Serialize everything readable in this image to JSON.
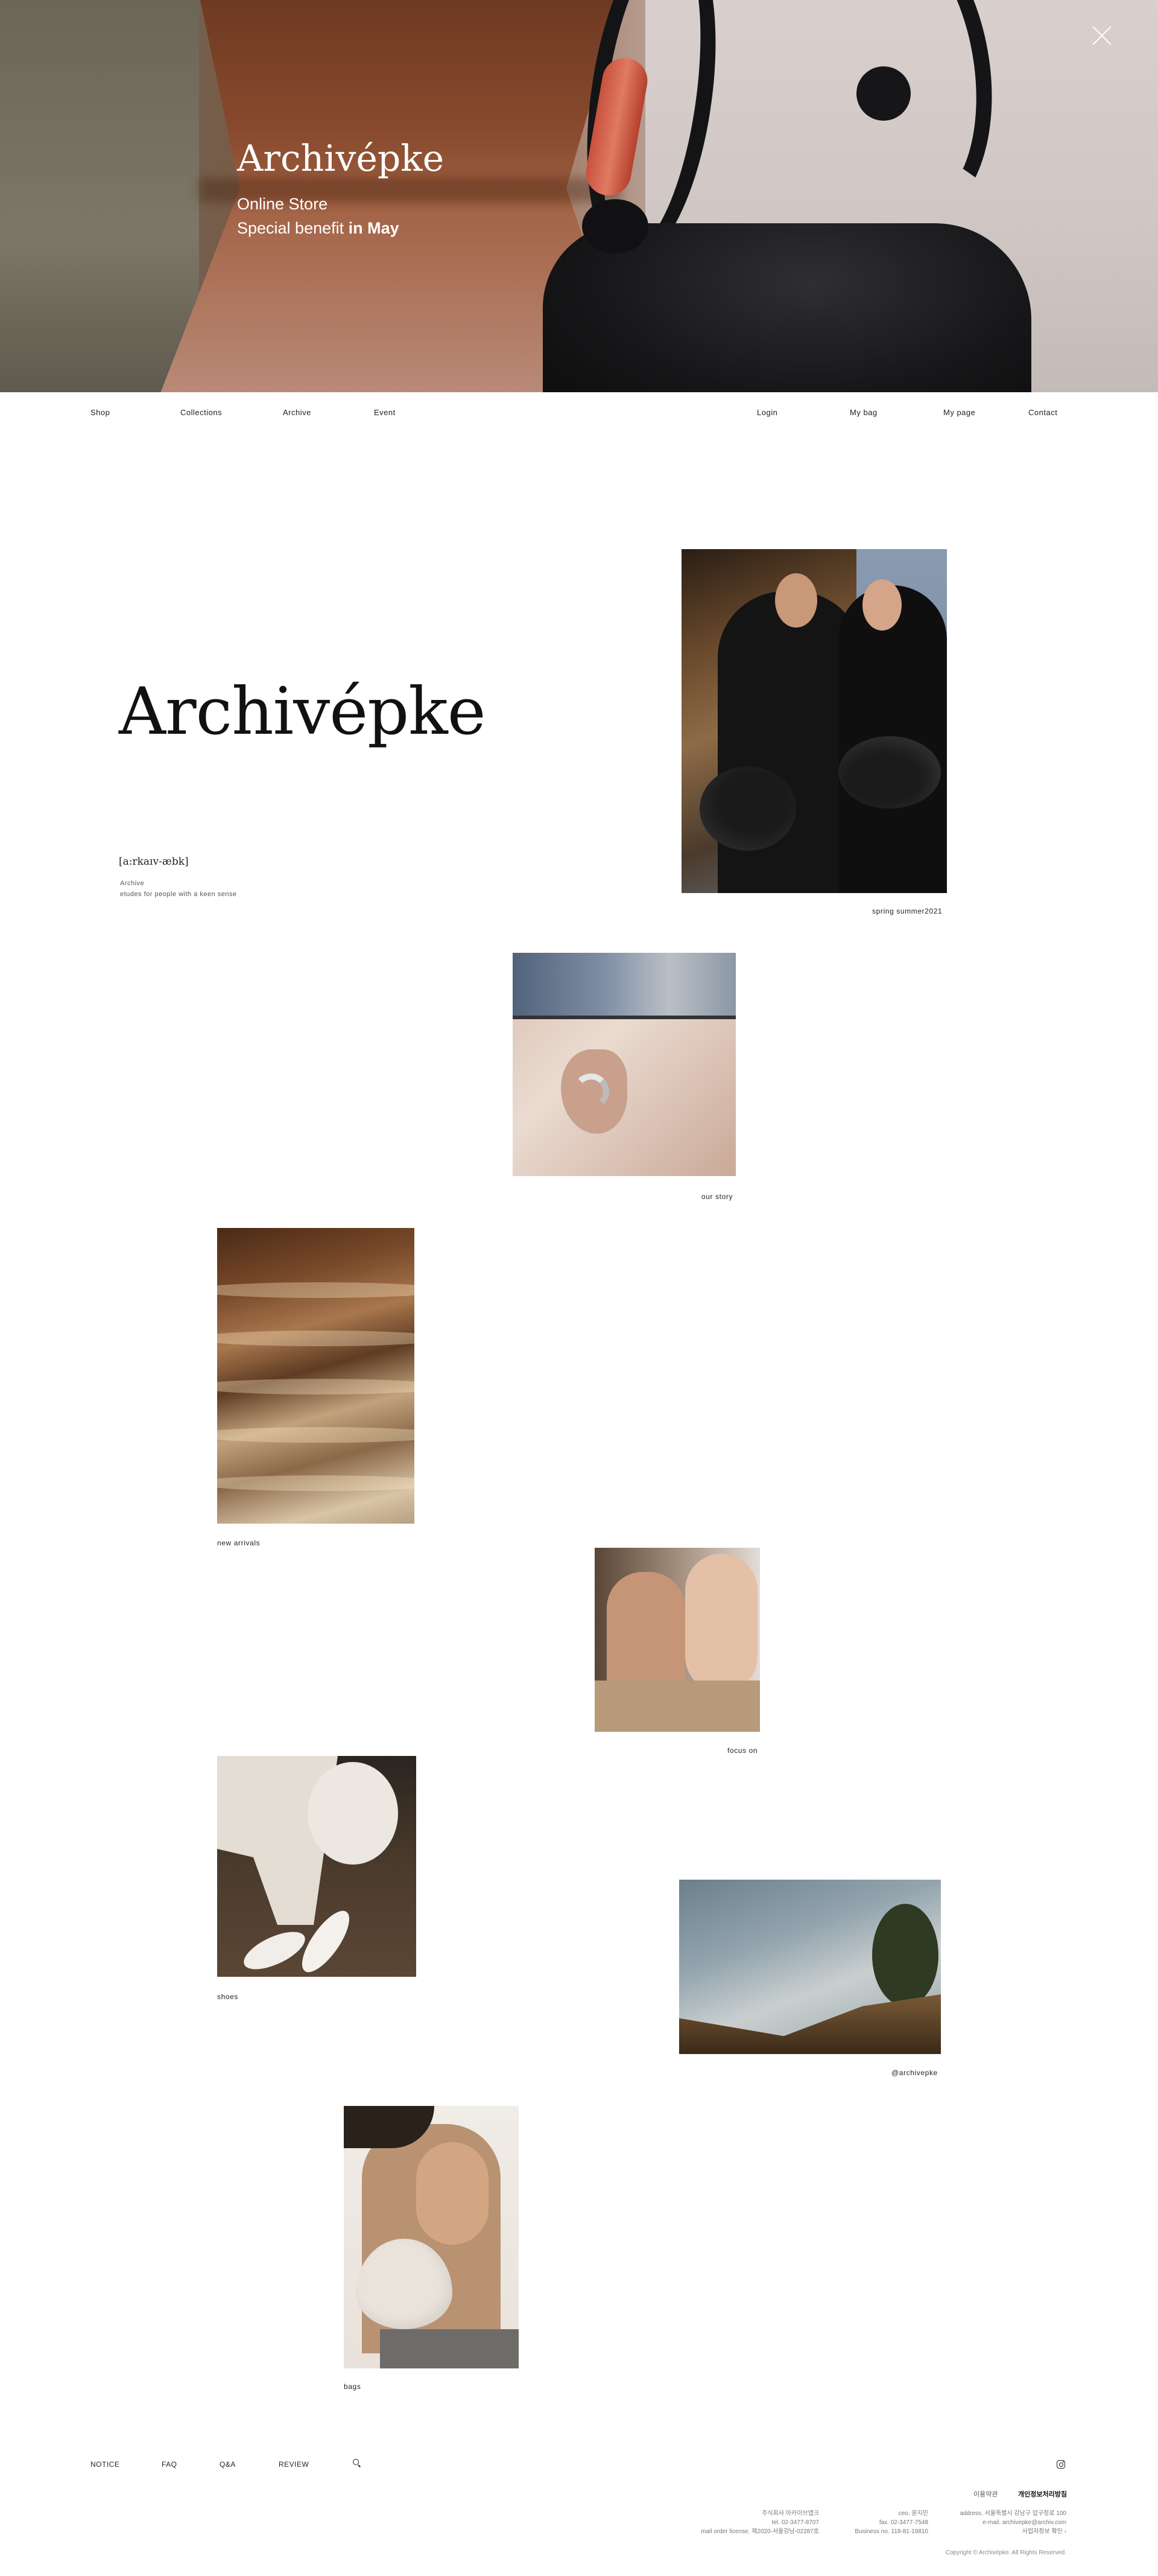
{
  "hero": {
    "brand": "Archivépke",
    "line1": "Online Store",
    "line2_prefix": "Special benefit ",
    "line2_bold": "in May"
  },
  "nav": {
    "left": [
      "Shop",
      "Collections",
      "Archive",
      "Event"
    ],
    "right": [
      "Login",
      "My bag",
      "My page",
      "Contact"
    ]
  },
  "intro": {
    "brand": "Archivépke",
    "pronunciation": "[a:rkaıv-æbk]",
    "definition_1": "Archive",
    "definition_2": "etudes for people with a keen sense"
  },
  "gallery": [
    {
      "caption": "spring summer2021"
    },
    {
      "caption": "our story"
    },
    {
      "caption": "new arrivals"
    },
    {
      "caption": "focus on"
    },
    {
      "caption": "shoes"
    },
    {
      "caption": "@archivepke"
    },
    {
      "caption": "bags"
    }
  ],
  "footer": {
    "links": [
      "NOTICE",
      "FAQ",
      "Q&A",
      "REVIEW"
    ],
    "legal": [
      "이용약관",
      "개인정보처리방침"
    ],
    "company": [
      "주식회사 아카이브앱크",
      "tel. 02-3477-8707",
      "mail order license. 제2020-서울강남-02287호"
    ],
    "ceo": [
      "ceo. 윤지민",
      "fax. 02-3477-7548",
      "Business no. 118-81-19810"
    ],
    "address": [
      "address. 서울특별시 강남구 압구정로 100",
      "e-mail. archivepke@archiv.com",
      "사업자정보 확인 ›"
    ],
    "copyright": "Copyright © Archivépke. All Rights Reserved."
  },
  "colors": {
    "accent": "#1a1a1a",
    "background": "#ffffff",
    "hero_text": "#ffffff"
  }
}
